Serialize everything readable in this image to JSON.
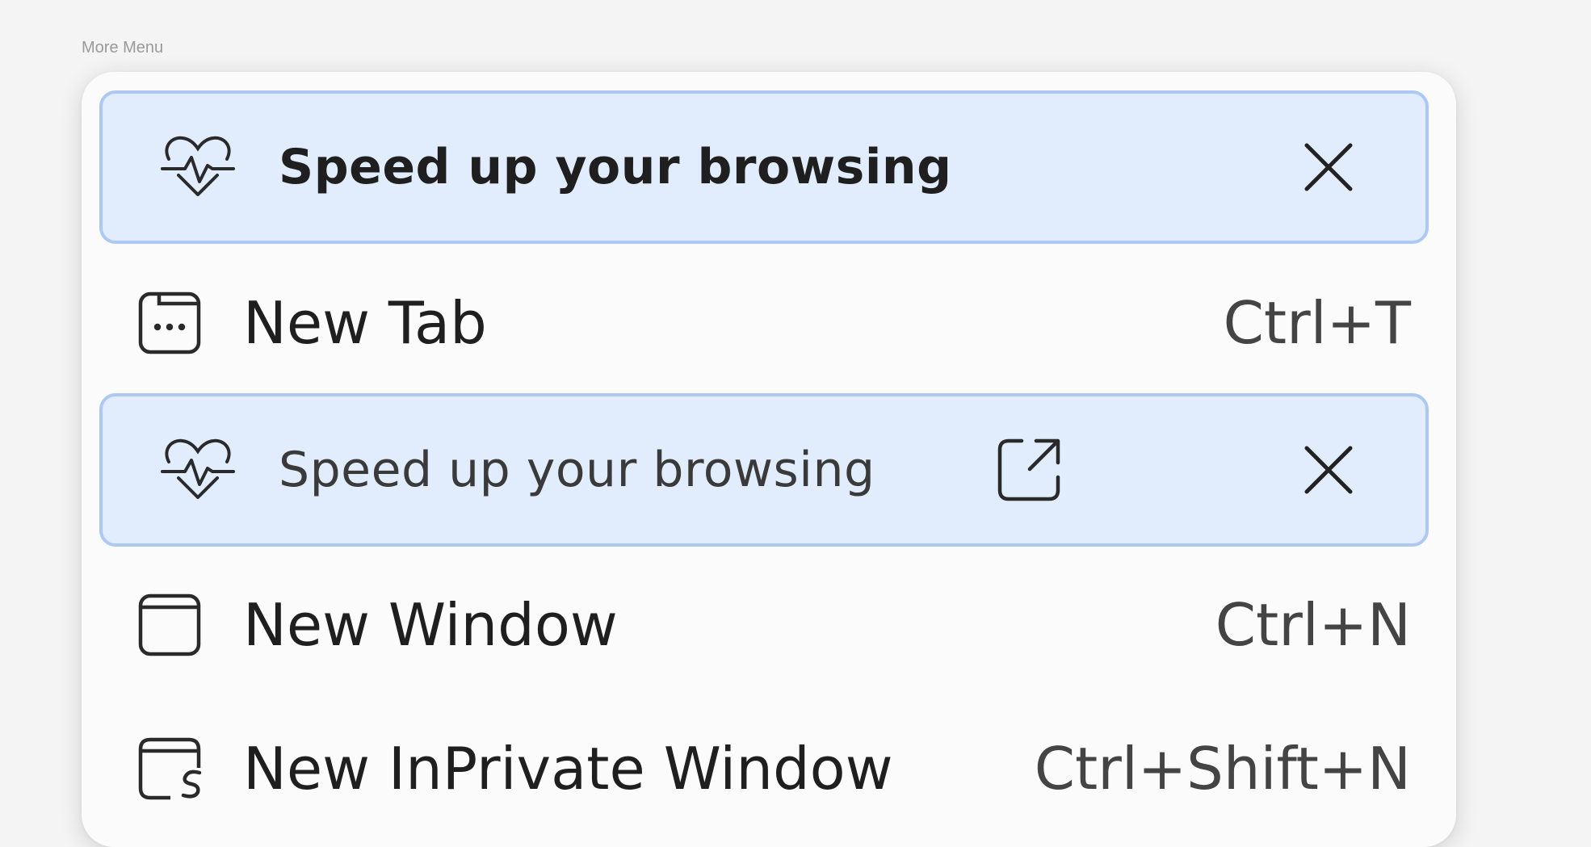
{
  "caption": "More Menu",
  "menu": {
    "promo_1": {
      "label": "Speed up your browsing",
      "icon": "heart-pulse-icon",
      "close_icon": "close-icon"
    },
    "new_tab": {
      "label": "New Tab",
      "shortcut": "Ctrl+T",
      "icon": "new-tab-icon"
    },
    "promo_2": {
      "label": "Speed up your browsing",
      "icon": "heart-pulse-icon",
      "external_icon": "external-link-icon",
      "close_icon": "close-icon"
    },
    "new_window": {
      "label": "New Window",
      "shortcut": "Ctrl+N",
      "icon": "window-icon"
    },
    "new_inprivate": {
      "label": "New InPrivate Window",
      "shortcut": "Ctrl+Shift+N",
      "icon": "inprivate-window-icon"
    }
  },
  "colors": {
    "promo_background": "#e1ecfd",
    "promo_border": "#aec8f4",
    "menu_background": "#fbfbfb",
    "page_background": "#f4f4f4"
  }
}
